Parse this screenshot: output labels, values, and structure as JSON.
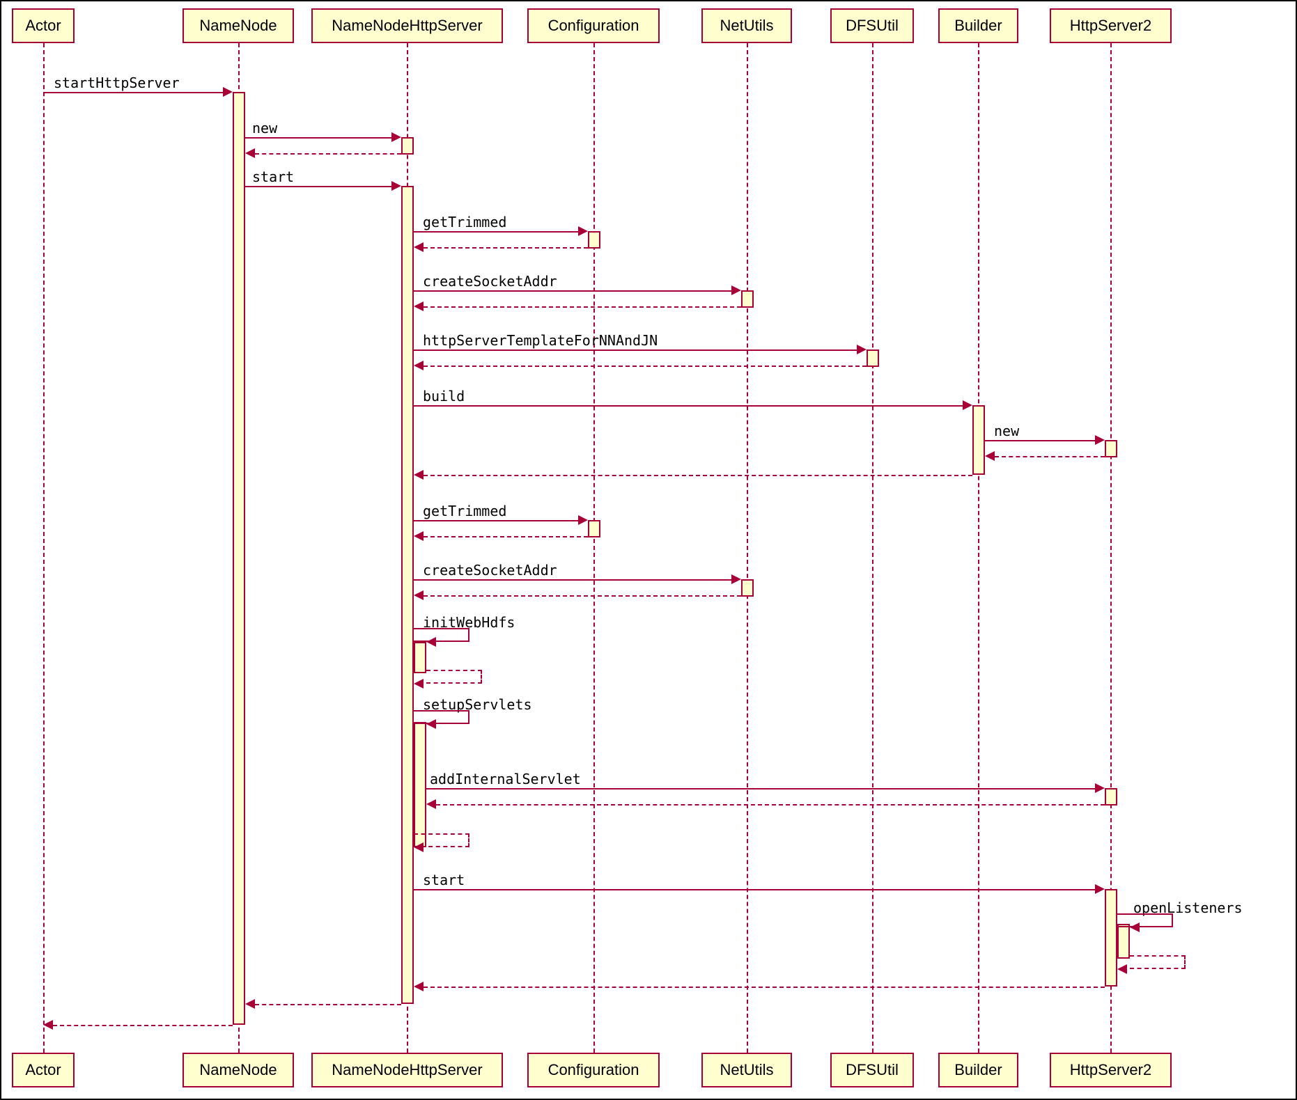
{
  "participants": {
    "actor": "Actor",
    "namenode": "NameNode",
    "nnhttpserver": "NameNodeHttpServer",
    "configuration": "Configuration",
    "netutils": "NetUtils",
    "dfsutil": "DFSUtil",
    "builder": "Builder",
    "httpserver2": "HttpServer2"
  },
  "messages": {
    "startHttpServer": "startHttpServer",
    "new1": "new",
    "start1": "start",
    "getTrimmed1": "getTrimmed",
    "createSocketAddr1": "createSocketAddr",
    "httpServerTemplate": "httpServerTemplateForNNAndJN",
    "build": "build",
    "new2": "new",
    "getTrimmed2": "getTrimmed",
    "createSocketAddr2": "createSocketAddr",
    "initWebHdfs": "initWebHdfs",
    "setupServlets": "setupServlets",
    "addInternalServlet": "addInternalServlet",
    "start2": "start",
    "openListeners": "openListeners"
  }
}
